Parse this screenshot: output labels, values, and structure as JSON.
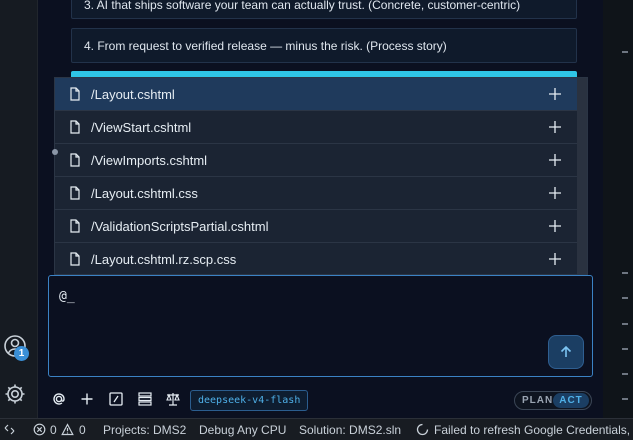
{
  "options": [
    {
      "text": "3. AI that ships software your team can actually trust. (Concrete, customer-centric)"
    },
    {
      "text": "4. From request to verified release — minus the risk. (Process story)"
    }
  ],
  "mention_dropdown": {
    "items": [
      {
        "label": "/Layout.cshtml"
      },
      {
        "label": "/ViewStart.cshtml"
      },
      {
        "label": "/ViewImports.cshtml"
      },
      {
        "label": "/Layout.cshtml.css"
      },
      {
        "label": "/ValidationScriptsPartial.cshtml"
      },
      {
        "label": "/Layout.cshtml.rz.scp.css"
      }
    ]
  },
  "input": {
    "value": "@_"
  },
  "toolbar": {
    "model": "deepseek-v4-flash",
    "mode_plan": "PLAN",
    "mode_act": "ACT",
    "icons": [
      "at-icon",
      "plus-icon",
      "slash-command-icon",
      "rules-icon",
      "scale-icon"
    ]
  },
  "activity": {
    "account_badge": "1"
  },
  "status_bar": {
    "errors": "0",
    "warnings": "0",
    "projects": "Projects: DMS2",
    "config": "Debug Any CPU",
    "solution": "Solution: DMS2.sln",
    "message": "Failed to refresh Google Credentials, r"
  },
  "colors": {
    "accent": "#2fc5e6",
    "focus_border": "#3b82c4",
    "selected_item": "#1f3a5c"
  }
}
